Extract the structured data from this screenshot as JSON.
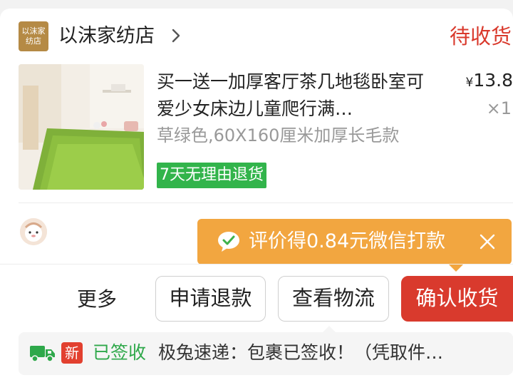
{
  "shop": {
    "logo_text": "以沫家纺店",
    "name": "以沫家纺店",
    "chevron_icon": "chevron-right-icon"
  },
  "order": {
    "status": "待收货"
  },
  "product": {
    "title": "买一送一加厚客厅茶几地毯卧室可爱少女床边儿童爬行满…",
    "price_currency": "¥",
    "price_value": "13.8",
    "quantity": "×1",
    "spec": "草绿色,60X160厘米加厚长毛款",
    "return_badge": "7天无理由退货"
  },
  "promo": {
    "icon": "wechat-pay-icon",
    "text": "评价得0.84元微信打款",
    "close_icon": "close-icon"
  },
  "actions": {
    "more": "更多",
    "refund": "申请退款",
    "logistics": "查看物流",
    "confirm": "确认收货"
  },
  "logistics": {
    "truck_icon": "truck-icon",
    "new_badge": "新",
    "status": "已签收",
    "detail": "极兔速递：包裹已签收！（凭取件…"
  },
  "colors": {
    "accent_red": "#d93a2d",
    "promo_orange": "#f2a640",
    "green": "#32b44b",
    "logo_gold": "#b58a45"
  }
}
